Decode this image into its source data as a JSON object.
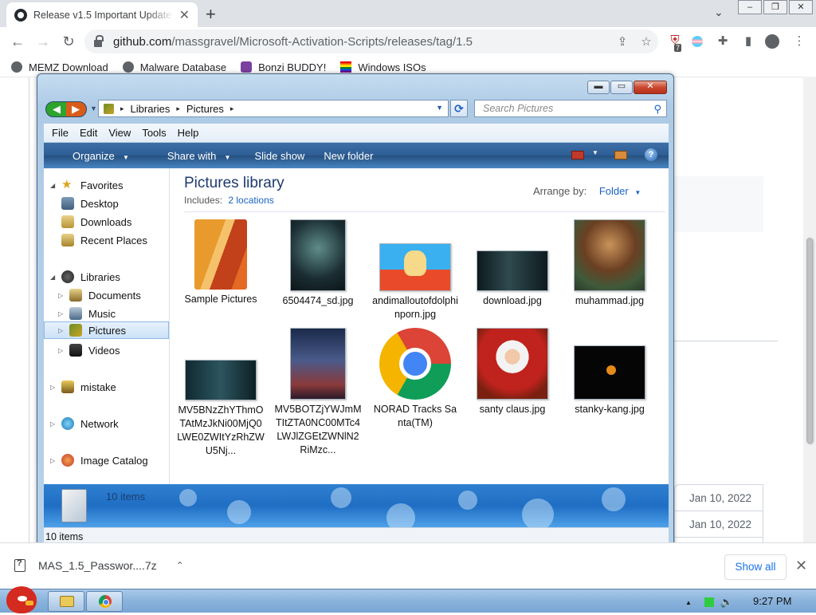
{
  "browser": {
    "tab_title": "Release v1.5 Important Update",
    "tab_close": "✕",
    "new_tab": "+",
    "url_host": "github.com",
    "url_path": "/massgravel/Microsoft-Activation-Scripts/releases/tag/1.5",
    "window_buttons": [
      "–",
      "❐",
      "✕"
    ],
    "extension_badge": "7",
    "bookmarks": [
      "MEMZ Download",
      "Malware Database",
      "Bonzi BUDDY!",
      "Windows ISOs"
    ]
  },
  "page": {
    "asset_dates": [
      "Jan 10, 2022",
      "Jan 10, 2022"
    ]
  },
  "explorer": {
    "breadcrumb": [
      "Libraries",
      "Pictures"
    ],
    "search_placeholder": "Search Pictures",
    "menu": [
      "File",
      "Edit",
      "View",
      "Tools",
      "Help"
    ],
    "commands": [
      "Organize",
      "Share with",
      "Slide show",
      "New folder"
    ],
    "nav": {
      "favorites": "Favorites",
      "desktop": "Desktop",
      "downloads": "Downloads",
      "recent": "Recent Places",
      "libraries": "Libraries",
      "documents": "Documents",
      "music": "Music",
      "pictures": "Pictures",
      "videos": "Videos",
      "mistake": "mistake",
      "network": "Network",
      "image_catalog": "Image Catalog"
    },
    "library_title": "Pictures library",
    "includes_label": "Includes:",
    "includes_link": "2 locations",
    "arrange_label": "Arrange by:",
    "arrange_value": "Folder",
    "items": [
      {
        "label": "Sample Pictures",
        "kind": "folder-icon"
      },
      {
        "label": "6504474_sd.jpg",
        "kind": "poster-thumb"
      },
      {
        "label": "andimalloutofdolphinporn.jpg",
        "kind": "cartoon-thumb"
      },
      {
        "label": "download.jpg",
        "kind": "face-thumb"
      },
      {
        "label": "muhammad.jpg",
        "kind": "painting-thumb"
      },
      {
        "label": "MV5BNzZhYThmOTAtMzJkNi00MjQ0LWE0ZWItYzRhZWU5Nj...",
        "kind": "dark-thumb"
      },
      {
        "label": "MV5BOTZjYWJmMTItZTA0NC00MTc4LWJlZGEtZWNlN2RiMzc...",
        "kind": "poster-thumb"
      },
      {
        "label": "NORAD Tracks Santa(TM)",
        "kind": "chrome-icon"
      },
      {
        "label": "santy claus.jpg",
        "kind": "santa-thumb"
      },
      {
        "label": "stanky-kang.jpg",
        "kind": "black-thumb"
      }
    ],
    "details_count": "10 items",
    "status_count": "10 items"
  },
  "downloads": {
    "file": "MAS_1.5_Passwor....7z",
    "show_all": "Show all"
  },
  "taskbar": {
    "clock": "9:27 PM"
  }
}
